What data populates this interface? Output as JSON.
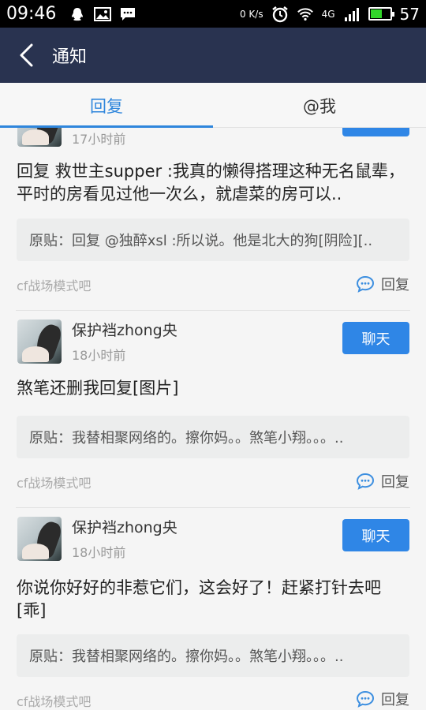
{
  "status_bar": {
    "time": "09:46",
    "net_speed": "0 K/s",
    "network_type": "4G",
    "battery": "57",
    "battery_level": 0.57,
    "icons": [
      "qq-icon",
      "image-icon",
      "message-icon",
      "alarm-icon",
      "wifi-icon",
      "signal-icon",
      "battery-icon"
    ]
  },
  "nav": {
    "title": "通知"
  },
  "tabs": [
    {
      "label": "回复",
      "active": true
    },
    {
      "label": "@我",
      "active": false
    }
  ],
  "posts": [
    {
      "time": "17小时前",
      "content": "回复 救世主supper :我真的懒得搭理这种无名鼠辈，平时的房看见过他一次么，就虐菜的房可以..",
      "quote": "原贴：回复 @独醉xsl :所以说。他是北大的狗[阴险][..",
      "forum": "cf战场模式吧",
      "reply_label": "回复"
    },
    {
      "user": "保护裆zhong央",
      "time": "18小时前",
      "chat_label": "聊天",
      "content": "煞笔还删我回复[图片]",
      "quote": "原贴：我替相聚网络的。擦你妈。。煞笔小翔。。。..",
      "forum": "cf战场模式吧",
      "reply_label": "回复"
    },
    {
      "user": "保护裆zhong央",
      "time": "18小时前",
      "chat_label": "聊天",
      "content": "你说你好好的非惹它们，这会好了！赶紧打针去吧[乖]",
      "quote": "原贴：我替相聚网络的。擦你妈。。煞笔小翔。。。..",
      "forum": "cf战场模式吧",
      "reply_label": "回复"
    }
  ],
  "colors": {
    "nav_bg": "#293350",
    "accent": "#2f86dc",
    "chat_button": "#2f86e6"
  }
}
